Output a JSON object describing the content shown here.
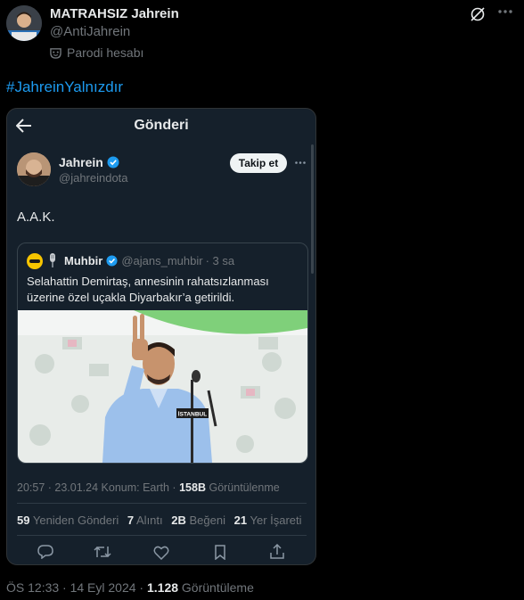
{
  "outer_post": {
    "display_name": "MATRAHSIZ Jahrein",
    "handle": "@AntiJahrein",
    "parody_label": "Parodi hesabı",
    "hashtag": "#JahreinYalnızdır",
    "timestamp": "ÖS 12:33 · 14 Eyl 2024 ·",
    "views_count": "1.128",
    "views_label": "Görüntüleme"
  },
  "embedded_screenshot": {
    "header_title": "Gönderi",
    "author": {
      "display_name": "Jahrein",
      "handle": "@jahreindota",
      "follow_label": "Takip et"
    },
    "post_text": "A.A.K.",
    "quote": {
      "display_name": "Muhbir",
      "handle": "@ajans_muhbir",
      "time": "· 3 sa",
      "text": "Selahattin Demirtaş, annesinin rahatsızlanması üzerine özel uçakla Diyarbakır’a getirildi.",
      "mic_sign": "İSTANBUL"
    },
    "meta": {
      "time_date": "20:57 · 23.01.24",
      "location": "Konum: Earth ·",
      "views_count": "158B",
      "views_label": "Görüntülenme"
    },
    "stats": [
      {
        "count": "59",
        "label": "Yeniden Gönderi"
      },
      {
        "count": "7",
        "label": "Alıntı"
      },
      {
        "count": "2B",
        "label": "Beğeni"
      },
      {
        "count": "21",
        "label": "Yer İşareti"
      }
    ]
  },
  "colors": {
    "link": "#1d9bf0",
    "verified": "#1d9bf0",
    "muted": "#71767b",
    "card_bg": "#15202b"
  },
  "icons": [
    "grok-icon",
    "parody-mask-icon",
    "back-arrow-icon",
    "verified-badge-icon",
    "more-icon",
    "reply-icon",
    "retweet-icon",
    "like-icon",
    "bookmark-icon",
    "share-icon"
  ]
}
